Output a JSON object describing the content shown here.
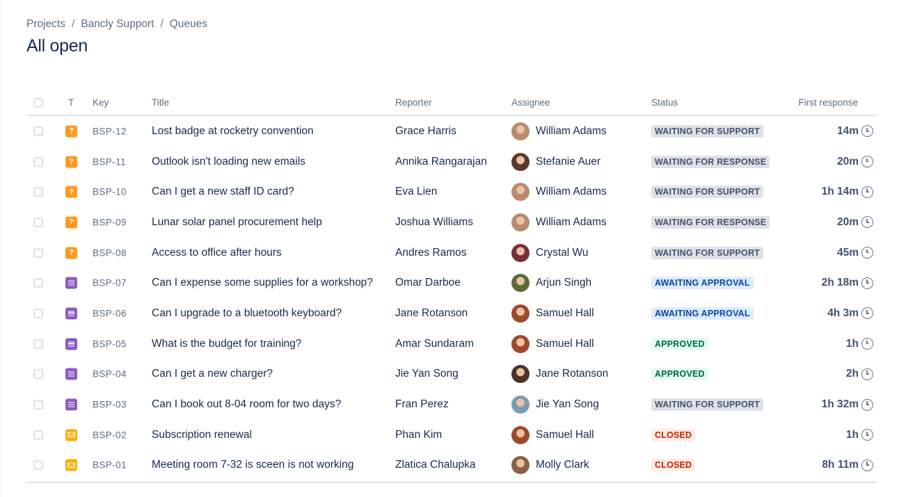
{
  "breadcrumb": {
    "items": [
      "Projects",
      "Bancly Support",
      "Queues"
    ],
    "separator": "/"
  },
  "page": {
    "title": "All open"
  },
  "table": {
    "columns": {
      "type": "T",
      "key": "Key",
      "title": "Title",
      "reporter": "Reporter",
      "assignee": "Assignee",
      "status": "Status",
      "first_response": "First response"
    },
    "rows": [
      {
        "type": "question",
        "key": "BSP-12",
        "title": "Lost badge at rocketry convention",
        "reporter": "Grace Harris",
        "assignee": "William Adams",
        "avatar_color": "#b98a6e",
        "status": "WAITING FOR SUPPORT",
        "status_style": "default",
        "first_response": "14m"
      },
      {
        "type": "question",
        "key": "BSP-11",
        "title": "Outlook isn't loading new emails",
        "reporter": "Annika Rangarajan",
        "assignee": "Stefanie Auer",
        "avatar_color": "#5a3a2a",
        "status": "WAITING FOR RESPONSE",
        "status_style": "default",
        "first_response": "20m"
      },
      {
        "type": "question",
        "key": "BSP-10",
        "title": "Can I get a new staff ID card?",
        "reporter": "Eva Lien",
        "assignee": "William Adams",
        "avatar_color": "#b98a6e",
        "status": "WAITING FOR SUPPORT",
        "status_style": "default",
        "first_response": "1h 14m"
      },
      {
        "type": "question",
        "key": "BSP-09",
        "title": "Lunar solar panel procurement help",
        "reporter": "Joshua Williams",
        "assignee": "William Adams",
        "avatar_color": "#b98a6e",
        "status": "WAITING FOR RESPONSE",
        "status_style": "default",
        "first_response": "20m"
      },
      {
        "type": "question",
        "key": "BSP-08",
        "title": "Access to office after hours",
        "reporter": "Andres Ramos",
        "assignee": "Crystal Wu",
        "avatar_color": "#7a2e3a",
        "status": "WAITING FOR SUPPORT",
        "status_style": "default",
        "first_response": "45m"
      },
      {
        "type": "request",
        "key": "BSP-07",
        "title": "Can I expense some supplies for a workshop?",
        "reporter": "Omar Darboe",
        "assignee": "Arjun Singh",
        "avatar_color": "#5b6b3a",
        "status": "AWAITING APPROVAL",
        "status_style": "blue",
        "first_response": "2h 18m"
      },
      {
        "type": "request",
        "key": "BSP-06",
        "title": "Can I upgrade to a bluetooth keyboard?",
        "reporter": "Jane Rotanson",
        "assignee": "Samuel Hall",
        "avatar_color": "#a0482c",
        "status": "AWAITING APPROVAL",
        "status_style": "blue",
        "first_response": "4h 3m"
      },
      {
        "type": "request",
        "key": "BSP-05",
        "title": "What is the budget for training?",
        "reporter": "Amar Sundaram",
        "assignee": "Samuel Hall",
        "avatar_color": "#a0482c",
        "status": "APPROVED",
        "status_style": "green",
        "first_response": "1h"
      },
      {
        "type": "request",
        "key": "BSP-04",
        "title": "Can I get a new charger?",
        "reporter": "Jie Yan Song",
        "assignee": "Jane Rotanson",
        "avatar_color": "#4a3328",
        "status": "APPROVED",
        "status_style": "green",
        "first_response": "2h"
      },
      {
        "type": "request",
        "key": "BSP-03",
        "title": "Can I book out 8-04 room for two days?",
        "reporter": "Fran Perez",
        "assignee": "Jie Yan Song",
        "avatar_color": "#7d9ab8",
        "status": "WAITING FOR SUPPORT",
        "status_style": "default",
        "first_response": "1h 32m"
      },
      {
        "type": "email",
        "key": "BSP-02",
        "title": "Subscription renewal",
        "reporter": "Phan Kim",
        "assignee": "Samuel Hall",
        "avatar_color": "#a0482c",
        "status": "CLOSED",
        "status_style": "red",
        "first_response": "1h"
      },
      {
        "type": "email",
        "key": "BSP-01",
        "title": "Meeting room 7-32 is sceen is not working",
        "reporter": "Zlatica Chalupka",
        "assignee": "Molly Clark",
        "avatar_color": "#8a6248",
        "status": "CLOSED",
        "status_style": "red",
        "first_response": "8h 11m"
      }
    ]
  }
}
